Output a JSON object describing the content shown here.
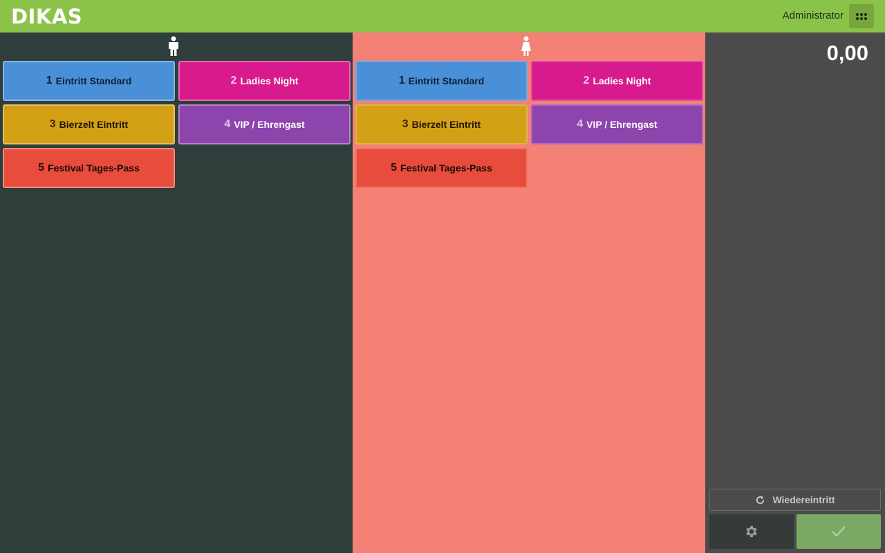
{
  "header": {
    "logo_text": "DIKAS",
    "user_name": "Administrator",
    "apps_icon": "grid-icon"
  },
  "panels": [
    {
      "gender": "male",
      "icon": "male-icon",
      "tiles": [
        {
          "number": "1",
          "label": "Eintritt Standard"
        },
        {
          "number": "2",
          "label": "Ladies Night"
        },
        {
          "number": "3",
          "label": "Bierzelt Eintritt"
        },
        {
          "number": "4",
          "label": "VIP / Ehrengast"
        },
        {
          "number": "5",
          "label": "Festival Tages-Pass"
        }
      ]
    },
    {
      "gender": "female",
      "icon": "female-icon",
      "tiles": [
        {
          "number": "1",
          "label": "Eintritt Standard"
        },
        {
          "number": "2",
          "label": "Ladies Night"
        },
        {
          "number": "3",
          "label": "Bierzelt Eintritt"
        },
        {
          "number": "4",
          "label": "VIP / Ehrengast"
        },
        {
          "number": "5",
          "label": "Festival Tages-Pass"
        }
      ]
    }
  ],
  "sidebar": {
    "total": "0,00",
    "reentry_label": "Wiedereintritt",
    "reentry_icon": "refresh-icon",
    "settings_icon": "gear-icon",
    "confirm_icon": "checkmark-icon"
  },
  "colors": {
    "header_bg": "#8bc34a",
    "male_panel_bg": "#2f3e3a",
    "female_panel_bg": "#f48175",
    "sidebar_bg": "#4b4b4b",
    "tile_1": "#4a90d9",
    "tile_2": "#d81b8c",
    "tile_3": "#d4a016",
    "tile_4": "#8e44ad",
    "tile_5": "#e74c3c",
    "confirm": "#7aa865"
  }
}
